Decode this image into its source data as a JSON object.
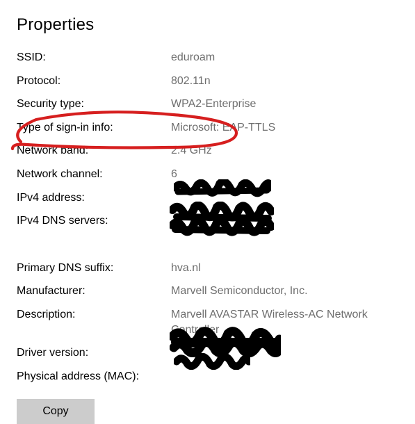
{
  "title": "Properties",
  "props": {
    "ssid_label": "SSID:",
    "ssid_value": "eduroam",
    "protocol_label": "Protocol:",
    "protocol_value": "802.11n",
    "security_label": "Security type:",
    "security_value": "WPA2-Enterprise",
    "signin_label": "Type of sign-in info:",
    "signin_value": "Microsoft: EAP-TTLS",
    "band_label": "Network band:",
    "band_value": "2.4 GHz",
    "channel_label": "Network channel:",
    "channel_value": "6",
    "ipv4_label": "IPv4 address:",
    "ipv4_value": "",
    "dns_label": "IPv4 DNS servers:",
    "dns_value": "",
    "suffix_label": "Primary DNS suffix:",
    "suffix_value": "hva.nl",
    "mfr_label": "Manufacturer:",
    "mfr_value": "Marvell Semiconductor, Inc.",
    "desc_label": "Description:",
    "desc_value": "Marvell AVASTAR Wireless-AC Network Controller",
    "driver_label": "Driver version:",
    "driver_value": "",
    "mac_label": "Physical address (MAC):",
    "mac_value": ""
  },
  "copy_label": "Copy",
  "annotations": {
    "highlight_color": "#d61f1f",
    "redaction_color": "#000000"
  }
}
